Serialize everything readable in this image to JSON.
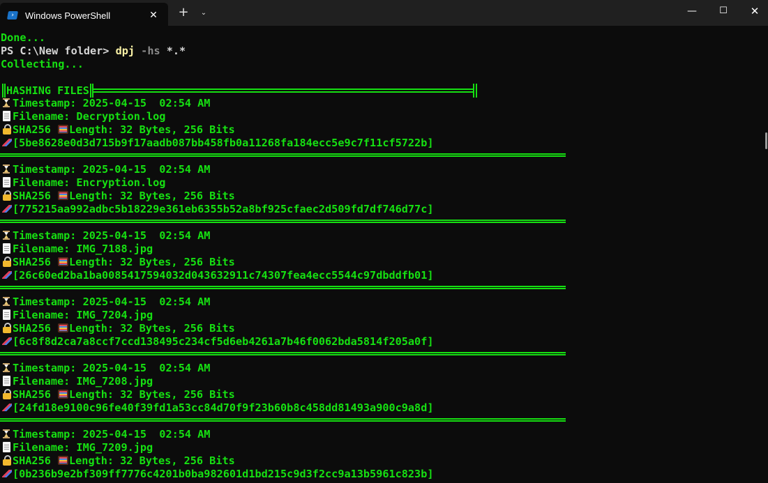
{
  "window": {
    "tab_title": "Windows PowerShell",
    "tab_close": "✕",
    "new_tab": "+",
    "dropdown": "⌄",
    "minimize": "—",
    "maximize": "☐",
    "close": "✕",
    "tab_icon": "powershell-icon"
  },
  "terminal": {
    "done": "Done...",
    "prompt": "PS C:\\New folder> ",
    "cmd": "dpj",
    "arg": " -hs ",
    "glob": "*.*",
    "collecting": "Collecting...",
    "header": "HASHING FILES",
    "timestamp_label": "Timestamp: 2025-04-15  02:54 AM",
    "algo_label": "SHA256 ",
    "length_label": "Length: 32 Bytes, 256 Bits",
    "entries": [
      {
        "filename": "Filename: Decryption.log",
        "hash": "[5be8628e0d3d715b9f17aadb087bb458fb0a11268fa184ecc5e9c7f11cf5722b]"
      },
      {
        "filename": "Filename: Encryption.log",
        "hash": "[775215aa992adbc5b18229e361eb6355b52a8bf925cfaec2d509fd7df746d77c]"
      },
      {
        "filename": "Filename: IMG_7188.jpg",
        "hash": "[26c60ed2ba1ba0085417594032d043632911c74307fea4ecc5544c97dbddfb01]"
      },
      {
        "filename": "Filename: IMG_7204.jpg",
        "hash": "[6c8f8d2ca7a8ccf7ccd138495c234cf5d6eb4261a7b46f0062bda5814f205a0f]"
      },
      {
        "filename": "Filename: IMG_7208.jpg",
        "hash": "[24fd18e9100c96fe40f39fd1a53cc84d70f9f23b60b8c458dd81493a900c9a8d]"
      },
      {
        "filename": "Filename: IMG_7209.jpg",
        "hash": "[0b236b9e2bf309ff7776c4201b0ba982601d1bd215c9d3f2cc9a13b5961c823b]"
      }
    ]
  },
  "colors": {
    "terminal_bg": "#0c0c0c",
    "output_green": "#16e012",
    "command_yellow": "#f9f1a5",
    "titlebar_bg": "#202020"
  }
}
